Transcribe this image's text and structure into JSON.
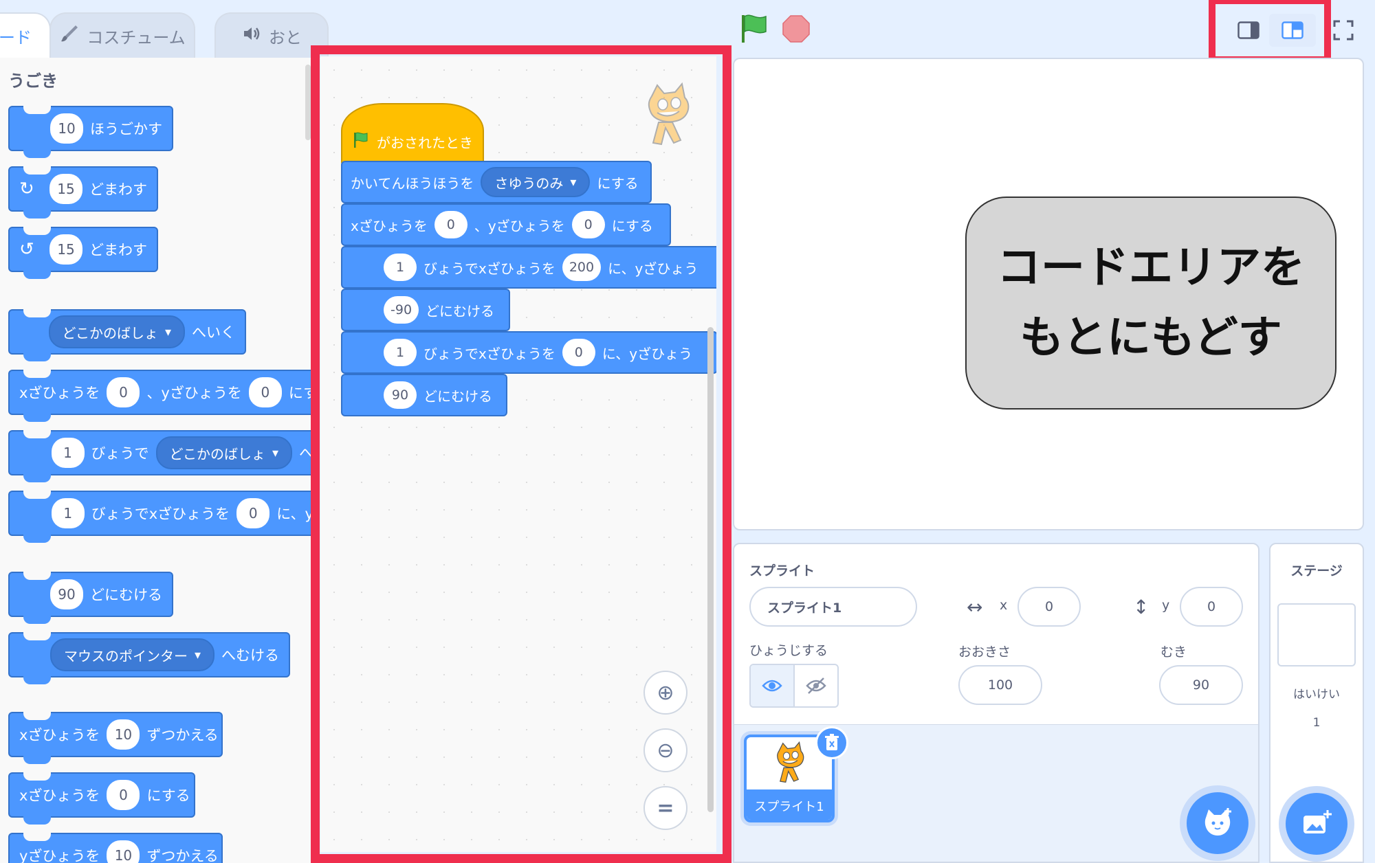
{
  "tabs": [
    {
      "label": "ード",
      "icon": "code-icon"
    },
    {
      "label": "コスチューム",
      "icon": "brush-icon"
    },
    {
      "label": "おと",
      "icon": "speaker-icon"
    }
  ],
  "palette": {
    "category": "うごき",
    "blocks": {
      "move": {
        "value": "10",
        "text": "ほうごかす"
      },
      "turn_right": {
        "value": "15",
        "text": "どまわす"
      },
      "turn_left": {
        "value": "15",
        "text": "どまわす"
      },
      "goto": {
        "dropdown": "どこかのばしょ",
        "text": "へいく"
      },
      "goto_xy": {
        "t1": "xざひょうを",
        "v1": "0",
        "t2": "、yざひょうを",
        "v2": "0",
        "t3": "にす"
      },
      "glide_to": {
        "value": "1",
        "text": "びょうで",
        "dropdown": "どこかのばしょ",
        "text2": "へ"
      },
      "glide_xy": {
        "value": "1",
        "text": "びょうでxざひょうを",
        "v2": "0",
        "text2": "に、y"
      },
      "point_dir": {
        "value": "90",
        "text": "どにむける"
      },
      "point_towards": {
        "dropdown": "マウスのポインター",
        "text": "へむける"
      },
      "change_x": {
        "t1": "xざひょうを",
        "value": "10",
        "t2": "ずつかえる"
      },
      "set_x": {
        "t1": "xざひょうを",
        "value": "0",
        "t2": "にする"
      },
      "change_y": {
        "t1": "yざひょうを",
        "value": "10",
        "t2": "ずつかえる"
      }
    }
  },
  "script": {
    "hat": "がおされたとき",
    "rotation": {
      "t1": "かいてんほうほうを",
      "dropdown": "さゆうのみ",
      "t2": "にする"
    },
    "goto_xy": {
      "t1": "xざひょうを",
      "v1": "0",
      "t2": "、yざひょうを",
      "v2": "0",
      "t3": "にする"
    },
    "glide1": {
      "v1": "1",
      "t1": "びょうでxざひょうを",
      "v2": "200",
      "t2": "に、yざひょう"
    },
    "point1": {
      "value": "-90",
      "text": "どにむける"
    },
    "glide2": {
      "v1": "1",
      "t1": "びょうでxざひょうを",
      "v2": "0",
      "t2": "に、yざひょう"
    },
    "point2": {
      "value": "90",
      "text": "どにむける"
    }
  },
  "callout": {
    "line1": "コードエリアを",
    "line2": "もとにもどす"
  },
  "sprite": {
    "label": "スプライト",
    "name": "スプライト1",
    "x_label": "x",
    "x": "0",
    "y_label": "y",
    "y": "0",
    "show_label": "ひょうじする",
    "size_label": "おおきさ",
    "size": "100",
    "direction_label": "むき",
    "direction": "90",
    "thumb_name": "スプライト1"
  },
  "stage_panel": {
    "title": "ステージ",
    "backdrops_label": "はいけい",
    "backdrops_count": "1"
  },
  "colors": {
    "motion": "#4c97ff",
    "events": "#ffbf00",
    "highlight": "#ef2e4e",
    "accent": "#4c97ff"
  }
}
